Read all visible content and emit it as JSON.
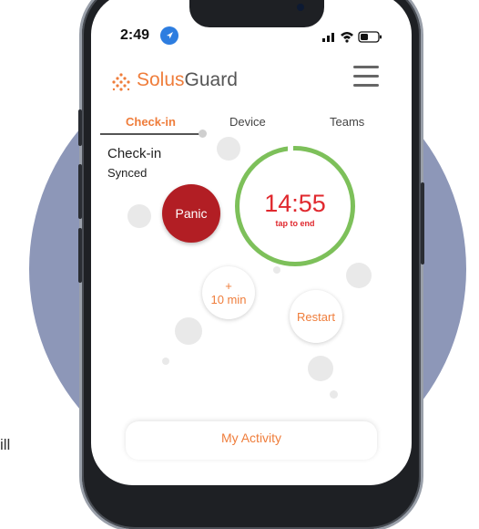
{
  "page": {
    "side_text": "ill"
  },
  "status_bar": {
    "time": "2:49",
    "location_icon": "location-arrow-icon",
    "icons": [
      "signal-icon",
      "wifi-icon",
      "battery-icon"
    ]
  },
  "header": {
    "logo_solus": "Solus",
    "logo_guard": "Guard",
    "menu_icon": "hamburger-menu-icon"
  },
  "tabs": [
    {
      "label": "Check-in",
      "active": true
    },
    {
      "label": "Device",
      "active": false
    },
    {
      "label": "Teams",
      "active": false
    }
  ],
  "checkin": {
    "title": "Check-in",
    "sync_status": "Synced",
    "panic_label": "Panic",
    "timer_value": "14:55",
    "timer_hint": "tap to end",
    "add_plus": "+",
    "add_label": "10 min",
    "restart_label": "Restart"
  },
  "footer": {
    "activity_label": "My Activity"
  },
  "colors": {
    "accent": "#ef7d3b",
    "panic": "#b21e24",
    "timer_text": "#e0282e",
    "timer_ring": "#7dc05a",
    "backdrop": "#8d97b8"
  }
}
